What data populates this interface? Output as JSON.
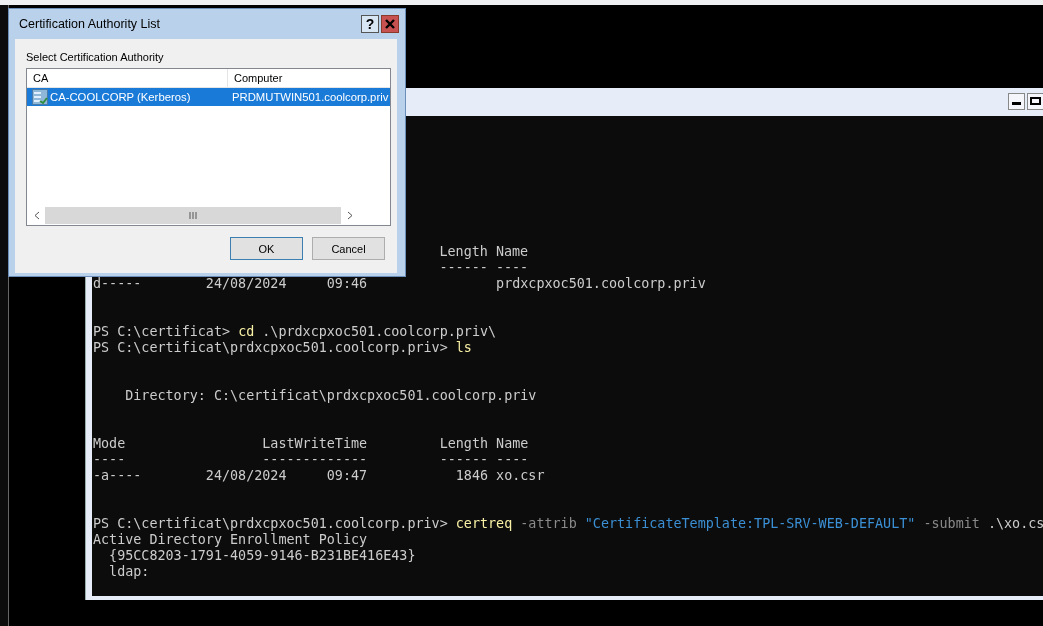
{
  "console": {
    "blocks": [
      [
        {
          "kind": "indented",
          "segments": [
            {
              "kind": "out",
              "text": "Length Name"
            }
          ]
        },
        {
          "kind": "indented",
          "segments": [
            {
              "kind": "out",
              "text": "------ ----"
            }
          ]
        },
        [
          {
            "kind": "out",
            "text": "d-----        24/08/2024     09:46                prdxcpxoc501.coolcorp.priv"
          }
        ]
      ],
      [
        [
          {
            "kind": "out",
            "text": "PS C:\\certificat> "
          },
          {
            "kind": "cmd",
            "text": "cd"
          },
          {
            "kind": "out",
            "text": " .\\prdxcpxoc501.coolcorp.priv\\"
          }
        ],
        [
          {
            "kind": "out",
            "text": "PS C:\\certificat\\prdxcpxoc501.coolcorp.priv> "
          },
          {
            "kind": "cmd",
            "text": "ls"
          }
        ]
      ],
      [
        [
          {
            "kind": "out",
            "text": "    Directory: C:\\certificat\\prdxcpxoc501.coolcorp.priv"
          }
        ]
      ],
      [
        [
          {
            "kind": "out",
            "text": "Mode                 LastWriteTime         Length Name"
          }
        ],
        [
          {
            "kind": "out",
            "text": "----                 -------------         ------ ----"
          }
        ],
        [
          {
            "kind": "out",
            "text": "-a----        24/08/2024     09:47           1846 xo.csr"
          }
        ]
      ],
      [
        [
          {
            "kind": "out",
            "text": "PS C:\\certificat\\prdxcpxoc501.coolcorp.priv> "
          },
          {
            "kind": "cmd",
            "text": "certreq"
          },
          {
            "kind": "param",
            "text": " -attrib "
          },
          {
            "kind": "string",
            "text": "\"CertificateTemplate:TPL-SRV-WEB-DEFAULT\""
          },
          {
            "kind": "param",
            "text": " -submit "
          },
          {
            "kind": "out",
            "text": ".\\xo.cs"
          }
        ],
        [
          {
            "kind": "out",
            "text": "Active Directory Enrollment Policy"
          }
        ],
        [
          {
            "kind": "out",
            "text": "  {95CC8203-1791-4059-9146-B231BE416E43}"
          }
        ],
        [
          {
            "kind": "out",
            "text": "  ldap:"
          }
        ]
      ]
    ]
  },
  "dialog": {
    "title": "Certification Authority List",
    "help_button": "?",
    "prompt": "Select Certification Authority",
    "columns": [
      "CA",
      "Computer"
    ],
    "rows": [
      {
        "ca": "CA-COOLCORP (Kerberos)",
        "computer": "PRDMUTWIN501.coolcorp.priv",
        "selected": true
      }
    ],
    "buttons": [
      "OK",
      "Cancel"
    ]
  }
}
